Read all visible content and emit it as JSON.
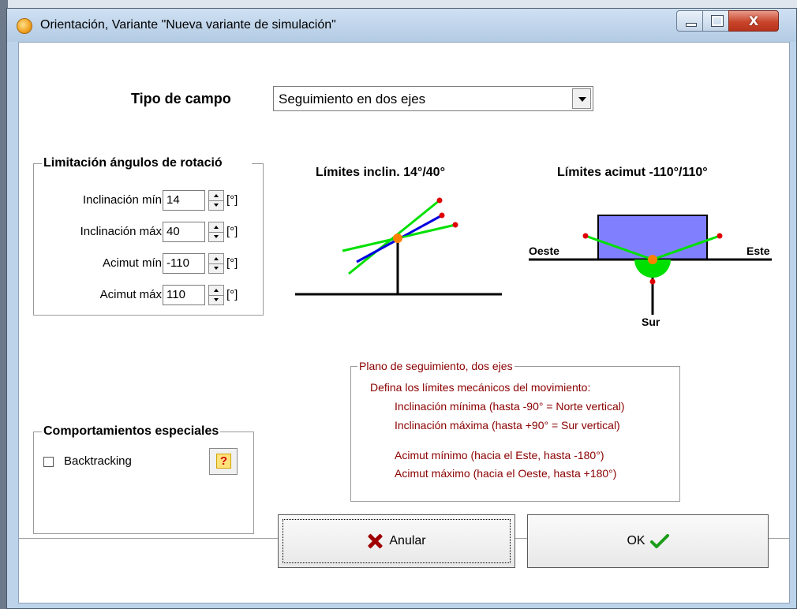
{
  "window": {
    "title": "Orientación, Variante \"Nueva variante de simulación\"",
    "close_glyph": "X"
  },
  "field_type": {
    "label": "Tipo de campo",
    "selected": "Seguimiento en dos ejes"
  },
  "rotation_limits": {
    "title": "Limitación ángulos de rotació",
    "fields": [
      {
        "label": "Inclinación mín",
        "value": "14",
        "unit": "[°]"
      },
      {
        "label": "Inclinación máx",
        "value": "40",
        "unit": "[°]"
      },
      {
        "label": "Acimut mín",
        "value": "-110",
        "unit": "[°]"
      },
      {
        "label": "Acimut máx",
        "value": "110",
        "unit": "[°]"
      }
    ]
  },
  "diagram": {
    "tilt_title": "Límites inclin. 14°/40°",
    "azimuth_title": "Límites acimut -110°/110°",
    "west_label": "Oeste",
    "east_label": "Este",
    "south_label": "Sur",
    "colors": {
      "panel_fill": "#8080ff",
      "green": "#00e000",
      "blue": "#0000e0",
      "pivot": "#ff8000",
      "limit_marker": "#e00000"
    }
  },
  "tracking_plane": {
    "title": "Plano de seguimiento, dos ejes",
    "lines": [
      "Defina los límites mecánicos del movimiento:",
      "Inclinación mínima (hasta -90° = Norte vertical)",
      "Inclinación máxima (hasta +90° = Sur vertical)",
      "Acimut mínimo (hacia el Este, hasta -180°)",
      "Acimut máximo (hacia el Oeste, hasta +180°)"
    ]
  },
  "special_behaviors": {
    "title": "Comportamientos especiales",
    "backtracking_label": "Backtracking",
    "backtracking_checked": false,
    "help_glyph": "?"
  },
  "buttons": {
    "cancel_label": "Anular",
    "ok_label": "OK"
  }
}
